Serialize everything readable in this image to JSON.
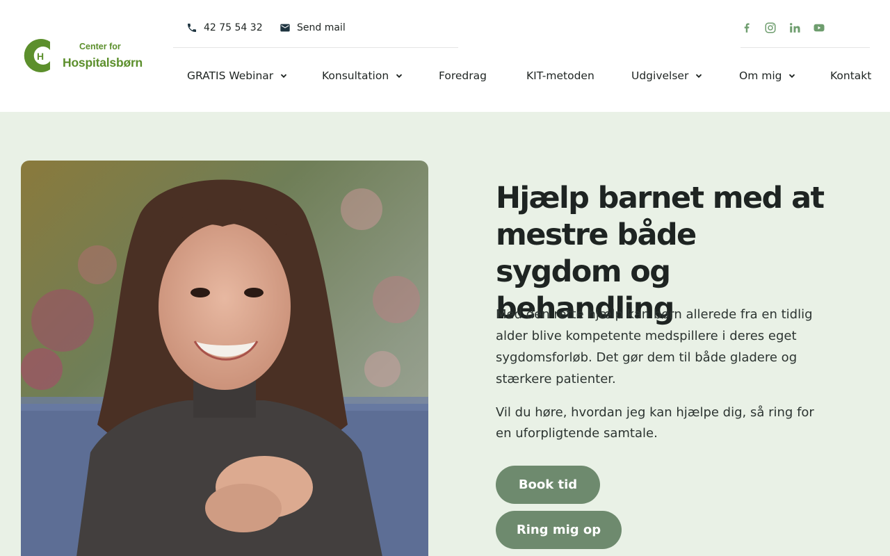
{
  "logo": {
    "letter": "H",
    "line1": "Center for",
    "line2": "Hospitalsbørn",
    "color": "#5c8f2c"
  },
  "header": {
    "phone": {
      "icon": "phone-icon",
      "label": "42 75 54 32"
    },
    "mail": {
      "icon": "envelope-icon",
      "label": "Send mail"
    },
    "social": [
      {
        "name": "facebook-icon"
      },
      {
        "name": "instagram-icon"
      },
      {
        "name": "linkedin-icon"
      },
      {
        "name": "youtube-icon"
      }
    ],
    "social_color": "#6e9d6e"
  },
  "nav": {
    "items": [
      {
        "label": "GRATIS Webinar",
        "has_dropdown": true
      },
      {
        "label": "Konsultation",
        "has_dropdown": true
      },
      {
        "label": "Foredrag",
        "has_dropdown": false
      },
      {
        "label": "KIT-metoden",
        "has_dropdown": false
      },
      {
        "label": "Udgivelser",
        "has_dropdown": true
      },
      {
        "label": "Om mig",
        "has_dropdown": true
      },
      {
        "label": "Kontakt",
        "has_dropdown": false
      }
    ]
  },
  "hero": {
    "background": "#e9f1e6",
    "headline": "Hjælp barnet med at mestre både sygdom og behandling",
    "paragraph1": "Med den rette hjælp kan børn allerede fra en tidlig alder blive kompetente medspillere i deres eget sygdomsforløb. Det gør dem til både gladere og stærkere patienter.",
    "paragraph2": "Vil du høre, hvordan jeg kan hjælpe dig, så ring for en uforpligtende samtale.",
    "buttons": {
      "book": "Book tid",
      "call": "Ring mig op"
    },
    "button_color": "#6e8a6e"
  }
}
